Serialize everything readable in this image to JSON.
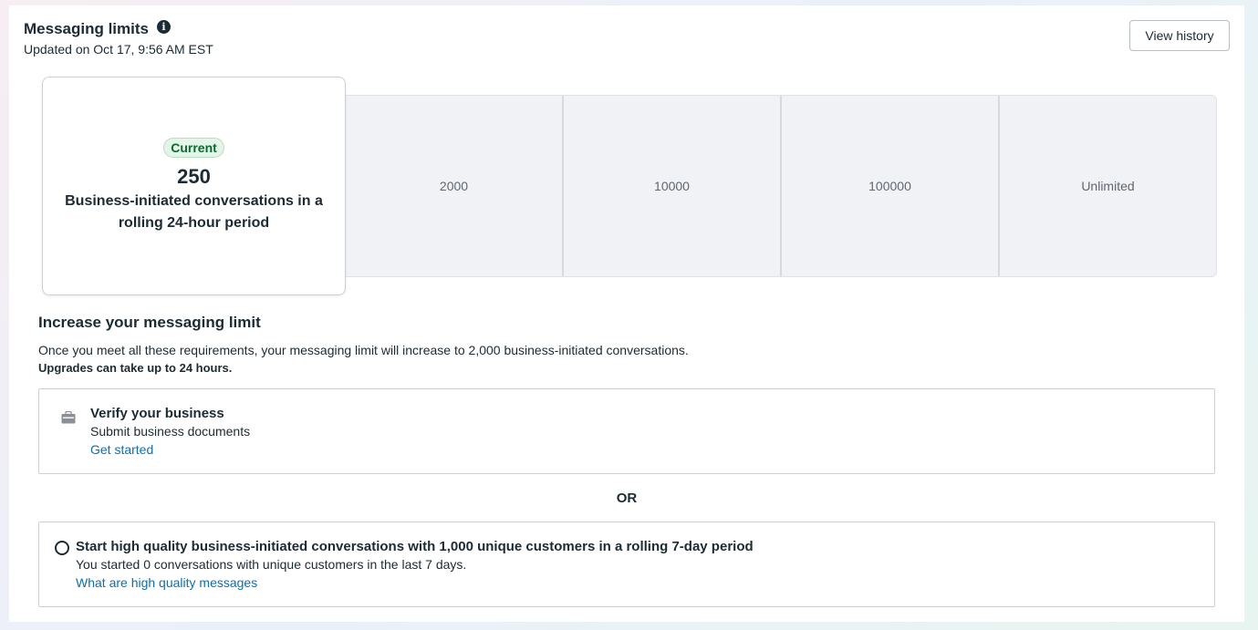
{
  "header": {
    "title": "Messaging limits",
    "updated": "Updated on Oct 17, 9:56 AM EST",
    "view_history_label": "View history"
  },
  "tiers": {
    "current": {
      "badge": "Current",
      "value": "250",
      "description": "Business-initiated conversations in a rolling 24-hour period"
    },
    "levels": [
      "2000",
      "10000",
      "100000",
      "Unlimited"
    ]
  },
  "increase": {
    "title": "Increase your messaging limit",
    "description": "Once you meet all these requirements, your messaging limit will increase to 2,000 business-initiated conversations.",
    "note": "Upgrades can take up to 24 hours."
  },
  "requirements": {
    "verify": {
      "title": "Verify your business",
      "subtitle": "Submit business documents",
      "link": "Get started"
    },
    "or_label": "OR",
    "conversations": {
      "title": "Start high quality business-initiated conversations with 1,000 unique customers in a rolling 7-day period",
      "subtitle": "You started 0 conversations with unique customers in the last 7 days.",
      "link": "What are high quality messages"
    }
  },
  "icons": {
    "info": "info-icon",
    "briefcase": "briefcase-icon",
    "radio": "radio-circle-icon"
  },
  "colors": {
    "current_badge_bg": "#e3f4e8",
    "current_badge_text": "#0a6b2f",
    "link": "#0a6fb5",
    "tier_bg": "#f0f2f5"
  }
}
